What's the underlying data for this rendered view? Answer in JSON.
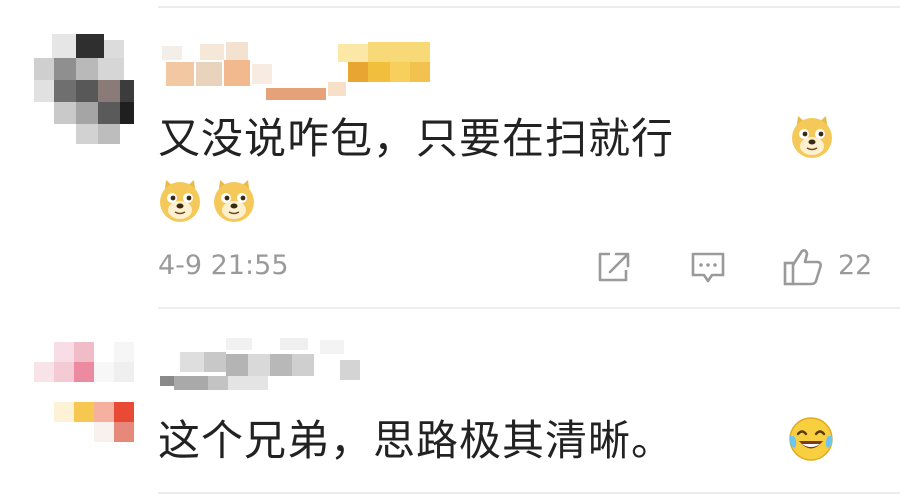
{
  "comments": [
    {
      "text_line1": "又没说咋包，只要在扫就行",
      "emoji_inline": "doge-emoji",
      "emoji_line2": [
        "doge-emoji",
        "doge-emoji"
      ],
      "timestamp": "4-9 21:55",
      "like_count": "22",
      "username": "",
      "avatar": "pixelated avatar"
    },
    {
      "text": "这个兄弟，思路极其清晰。",
      "emoji": "laughing-tears-emoji",
      "username": "",
      "avatar": "pixelated avatar"
    }
  ],
  "icons": {
    "share": "share-icon",
    "reply": "comment-icon",
    "like": "thumbs-up-icon"
  },
  "colors": {
    "text": "#222222",
    "meta": "#9a9a9a",
    "divider": "#ececec"
  }
}
